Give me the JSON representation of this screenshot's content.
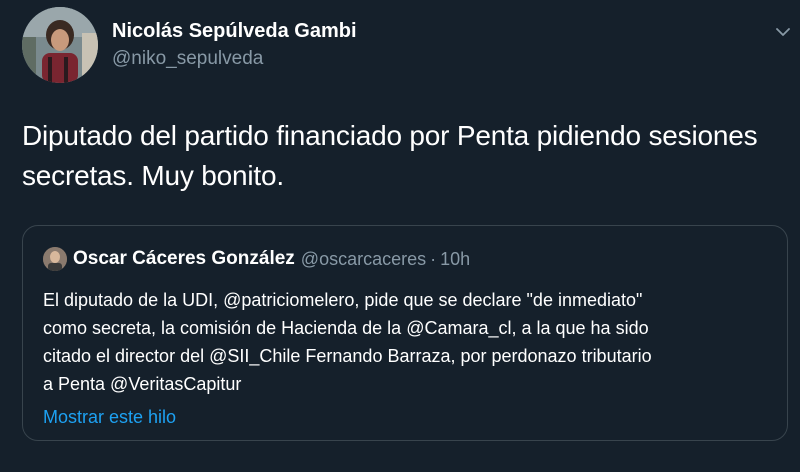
{
  "tweet": {
    "author": {
      "display_name": "Nicolás Sepúlveda Gambi",
      "handle": "@niko_sepulveda"
    },
    "text_lines": [
      "Diputado del partido financiado por Penta pidiendo sesiones",
      "secretas. Muy bonito."
    ],
    "quoted": {
      "display_name": "Oscar Cáceres González",
      "handle": "@oscarcaceres",
      "separator": "·",
      "time": "10h",
      "text_lines": [
        "El diputado de la UDI, @patriciomelero, pide que se declare \"de inmediato\"",
        "como secreta, la comisión de Hacienda de la @Camara_cl,  a la que ha sido",
        "citado el director del @SII_Chile Fernando Barraza, por perdonazo tributario",
        "a Penta @VeritasCapitur"
      ],
      "show_thread": "Mostrar este hilo"
    }
  },
  "colors": {
    "background": "#15202b",
    "text_primary": "#ffffff",
    "text_secondary": "#8899a6",
    "link": "#1da1f2",
    "border": "#38444d"
  },
  "icons": {
    "caret": "chevron-down-icon"
  }
}
